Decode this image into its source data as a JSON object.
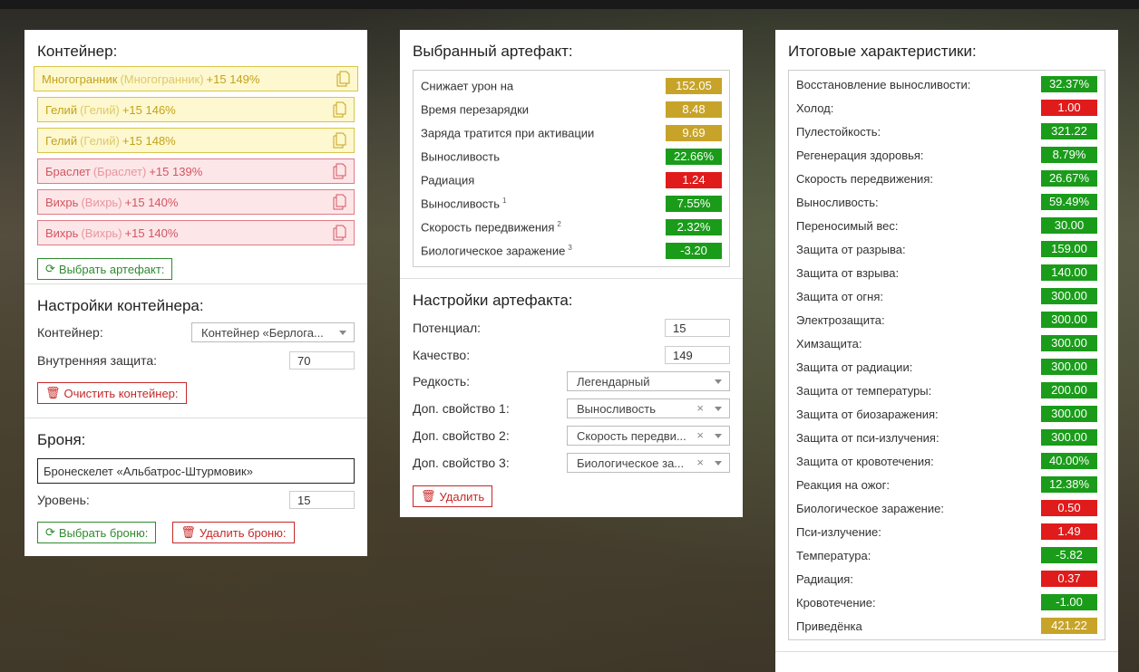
{
  "container": {
    "title": "Контейнер:",
    "artifacts": [
      {
        "name": "Многогранник",
        "alias": "(Многогранник)",
        "level": "+15 149%",
        "color": "yellow"
      },
      {
        "name": "Гелий",
        "alias": "(Гелий)",
        "level": "+15 146%",
        "color": "yellow"
      },
      {
        "name": "Гелий",
        "alias": "(Гелий)",
        "level": "+15 148%",
        "color": "yellow"
      },
      {
        "name": "Браслет",
        "alias": "(Браслет)",
        "level": "+15 139%",
        "color": "red"
      },
      {
        "name": "Вихрь",
        "alias": "(Вихрь)",
        "level": "+15 140%",
        "color": "red"
      },
      {
        "name": "Вихрь",
        "alias": "(Вихрь)",
        "level": "+15 140%",
        "color": "red"
      }
    ],
    "select_button": "Выбрать артефакт:"
  },
  "container_settings": {
    "title": "Настройки контейнера:",
    "container_label": "Контейнер:",
    "container_value": "Контейнер «Берлога...",
    "inner_protection_label": "Внутренняя защита:",
    "inner_protection_value": "70",
    "clear_button": "Очистить контейнер:"
  },
  "armor": {
    "title": "Броня:",
    "name": "Бронескелет «Альбатрос-Штурмовик»",
    "level_label": "Уровень:",
    "level_value": "15",
    "select_button": "Выбрать броню:",
    "delete_button": "Удалить броню:"
  },
  "selected_artifact": {
    "title": "Выбранный артефакт:",
    "stats": [
      {
        "label": "Снижает урон на",
        "sup": "",
        "value": "152.05",
        "color": "gold"
      },
      {
        "label": "Время перезарядки",
        "sup": "",
        "value": "8.48",
        "color": "gold"
      },
      {
        "label": "Заряда тратится при активации",
        "sup": "",
        "value": "9.69",
        "color": "gold"
      },
      {
        "label": "Выносливость",
        "sup": "",
        "value": "22.66%",
        "color": "green"
      },
      {
        "label": "Радиация",
        "sup": "",
        "value": "1.24",
        "color": "red"
      },
      {
        "label": "Выносливость",
        "sup": "1",
        "value": "7.55%",
        "color": "green"
      },
      {
        "label": "Скорость передвижения",
        "sup": "2",
        "value": "2.32%",
        "color": "green"
      },
      {
        "label": "Биологическое заражение",
        "sup": "3",
        "value": "-3.20",
        "color": "green"
      }
    ]
  },
  "artifact_settings": {
    "title": "Настройки артефакта:",
    "potential_label": "Потенциал:",
    "potential_value": "15",
    "quality_label": "Качество:",
    "quality_value": "149",
    "rarity_label": "Редкость:",
    "rarity_value": "Легендарный",
    "extra1_label": "Доп. свойство 1:",
    "extra1_value": "Выносливость",
    "extra2_label": "Доп. свойство 2:",
    "extra2_value": "Скорость передви...",
    "extra3_label": "Доп. свойство 3:",
    "extra3_value": "Биологическое за...",
    "clear_symbol": "×",
    "delete_button": "Удалить"
  },
  "totals": {
    "title": "Итоговые характеристики:",
    "stats": [
      {
        "label": "Восстановление выносливости:",
        "value": "32.37%",
        "color": "green"
      },
      {
        "label": "Холод:",
        "value": "1.00",
        "color": "red"
      },
      {
        "label": "Пулестойкость:",
        "value": "321.22",
        "color": "green"
      },
      {
        "label": "Регенерация здоровья:",
        "value": "8.79%",
        "color": "green"
      },
      {
        "label": "Скорость передвижения:",
        "value": "26.67%",
        "color": "green"
      },
      {
        "label": "Выносливость:",
        "value": "59.49%",
        "color": "green"
      },
      {
        "label": "Переносимый вес:",
        "value": "30.00",
        "color": "green"
      },
      {
        "label": "Защита от разрыва:",
        "value": "159.00",
        "color": "green"
      },
      {
        "label": "Защита от взрыва:",
        "value": "140.00",
        "color": "green"
      },
      {
        "label": "Защита от огня:",
        "value": "300.00",
        "color": "green"
      },
      {
        "label": "Электрозащита:",
        "value": "300.00",
        "color": "green"
      },
      {
        "label": "Химзащита:",
        "value": "300.00",
        "color": "green"
      },
      {
        "label": "Защита от радиации:",
        "value": "300.00",
        "color": "green"
      },
      {
        "label": "Защита от температуры:",
        "value": "200.00",
        "color": "green"
      },
      {
        "label": "Защита от биозаражения:",
        "value": "300.00",
        "color": "green"
      },
      {
        "label": "Защита от пси-излучения:",
        "value": "300.00",
        "color": "green"
      },
      {
        "label": "Защита от кровотечения:",
        "value": "40.00%",
        "color": "green"
      },
      {
        "label": "Реакция на ожог:",
        "value": "12.38%",
        "color": "green"
      },
      {
        "label": "Биологическое заражение:",
        "value": "0.50",
        "color": "red"
      },
      {
        "label": "Пси-излучение:",
        "value": "1.49",
        "color": "red"
      },
      {
        "label": "Температура:",
        "value": "-5.82",
        "color": "green"
      },
      {
        "label": "Радиация:",
        "value": "0.37",
        "color": "red"
      },
      {
        "label": "Кровотечение:",
        "value": "-1.00",
        "color": "green"
      },
      {
        "label": "Приведёнка",
        "value": "421.22",
        "color": "gold"
      }
    ]
  },
  "colors": {
    "green": "#1a9c1a",
    "red": "#e01b1b",
    "gold": "#c7a429"
  }
}
